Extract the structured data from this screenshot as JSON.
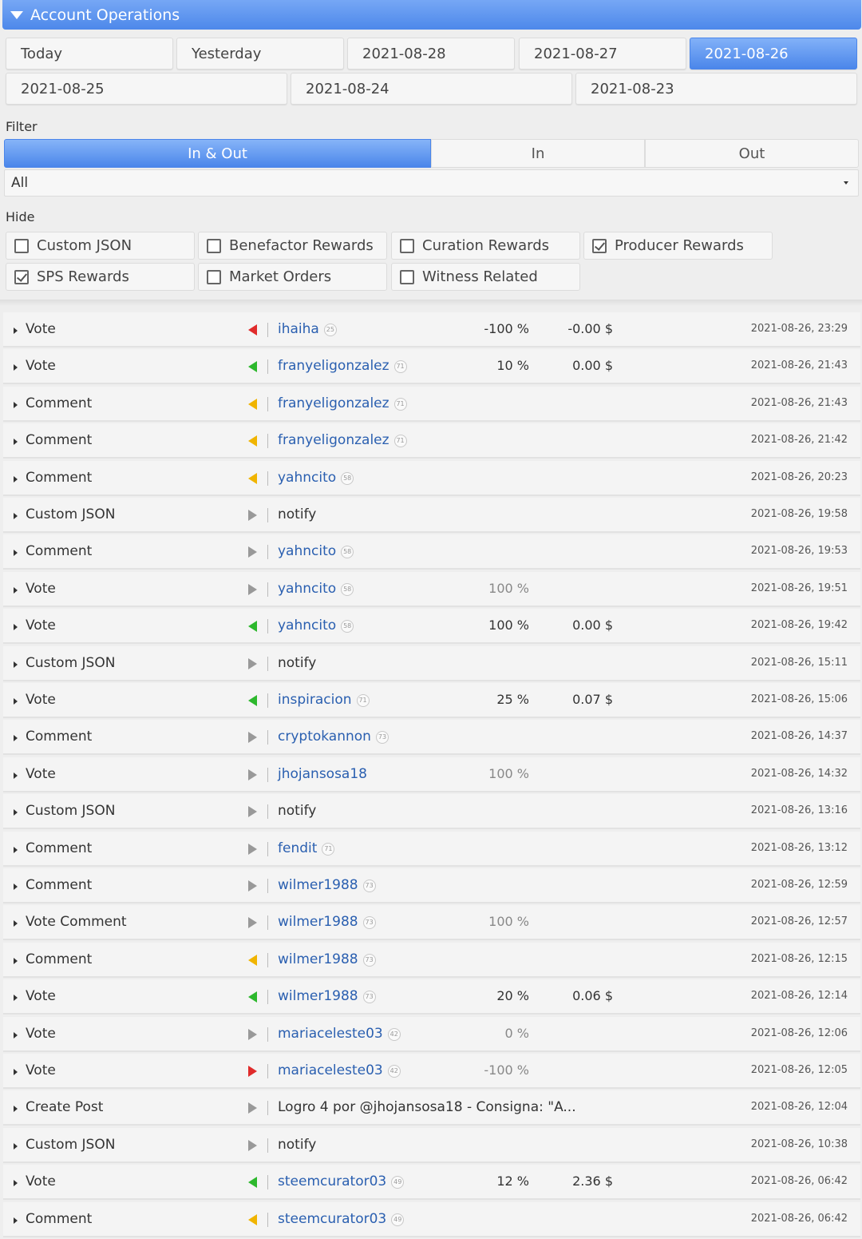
{
  "header": {
    "title": "Account Operations"
  },
  "dates": {
    "row1": [
      "Today",
      "Yesterday",
      "2021-08-28",
      "2021-08-27",
      "2021-08-26"
    ],
    "row2": [
      "2021-08-25",
      "2021-08-24",
      "2021-08-23"
    ],
    "selected": "2021-08-26"
  },
  "filter": {
    "label": "Filter",
    "segments": [
      "In & Out",
      "In",
      "Out"
    ],
    "selected_segment": "In & Out",
    "select_value": "All"
  },
  "hide": {
    "label": "Hide",
    "options": [
      {
        "label": "Custom JSON",
        "checked": false
      },
      {
        "label": "Benefactor Rewards",
        "checked": false
      },
      {
        "label": "Curation Rewards",
        "checked": false
      },
      {
        "label": "Producer Rewards",
        "checked": true
      },
      {
        "label": "SPS Rewards",
        "checked": true
      },
      {
        "label": "Market Orders",
        "checked": false
      },
      {
        "label": "Witness Related",
        "checked": false
      }
    ]
  },
  "colors": {
    "accent": "#4d88ea",
    "in_green": "#2db82d",
    "out_red": "#e02b2b",
    "comment_orange": "#f0b400",
    "neutral_gray": "#999999",
    "link_blue": "#2a5fb0"
  },
  "operations": [
    {
      "type": "Vote",
      "dir": "left",
      "color": "red",
      "account": "ihaiha",
      "rep": "25",
      "pct": "-100 %",
      "pct_gray": false,
      "amount": "-0.00 $",
      "ts": "2021-08-26, 23:29"
    },
    {
      "type": "Vote",
      "dir": "left",
      "color": "green",
      "account": "franyeligonzalez",
      "rep": "71",
      "pct": "10 %",
      "pct_gray": false,
      "amount": "0.00 $",
      "ts": "2021-08-26, 21:43"
    },
    {
      "type": "Comment",
      "dir": "left",
      "color": "orange",
      "account": "franyeligonzalez",
      "rep": "71",
      "pct": "",
      "pct_gray": false,
      "amount": "",
      "ts": "2021-08-26, 21:43"
    },
    {
      "type": "Comment",
      "dir": "left",
      "color": "orange",
      "account": "franyeligonzalez",
      "rep": "71",
      "pct": "",
      "pct_gray": false,
      "amount": "",
      "ts": "2021-08-26, 21:42"
    },
    {
      "type": "Comment",
      "dir": "left",
      "color": "orange",
      "account": "yahncito",
      "rep": "58",
      "pct": "",
      "pct_gray": false,
      "amount": "",
      "ts": "2021-08-26, 20:23"
    },
    {
      "type": "Custom JSON",
      "dir": "right",
      "color": "gray",
      "account": "notify",
      "rep": "",
      "plain": true,
      "pct": "",
      "pct_gray": false,
      "amount": "",
      "ts": "2021-08-26, 19:58"
    },
    {
      "type": "Comment",
      "dir": "right",
      "color": "gray",
      "account": "yahncito",
      "rep": "58",
      "pct": "",
      "pct_gray": false,
      "amount": "",
      "ts": "2021-08-26, 19:53"
    },
    {
      "type": "Vote",
      "dir": "right",
      "color": "gray",
      "account": "yahncito",
      "rep": "58",
      "pct": "100 %",
      "pct_gray": true,
      "amount": "",
      "ts": "2021-08-26, 19:51"
    },
    {
      "type": "Vote",
      "dir": "left",
      "color": "green",
      "account": "yahncito",
      "rep": "58",
      "pct": "100 %",
      "pct_gray": false,
      "amount": "0.00 $",
      "ts": "2021-08-26, 19:42"
    },
    {
      "type": "Custom JSON",
      "dir": "right",
      "color": "gray",
      "account": "notify",
      "rep": "",
      "plain": true,
      "pct": "",
      "pct_gray": false,
      "amount": "",
      "ts": "2021-08-26, 15:11"
    },
    {
      "type": "Vote",
      "dir": "left",
      "color": "green",
      "account": "inspiracion",
      "rep": "71",
      "pct": "25 %",
      "pct_gray": false,
      "amount": "0.07 $",
      "ts": "2021-08-26, 15:06"
    },
    {
      "type": "Comment",
      "dir": "right",
      "color": "gray",
      "account": "cryptokannon",
      "rep": "73",
      "pct": "",
      "pct_gray": false,
      "amount": "",
      "ts": "2021-08-26, 14:37"
    },
    {
      "type": "Vote",
      "dir": "right",
      "color": "gray",
      "account": "jhojansosa18",
      "rep": "",
      "pct": "100 %",
      "pct_gray": true,
      "amount": "",
      "ts": "2021-08-26, 14:32"
    },
    {
      "type": "Custom JSON",
      "dir": "right",
      "color": "gray",
      "account": "notify",
      "rep": "",
      "plain": true,
      "pct": "",
      "pct_gray": false,
      "amount": "",
      "ts": "2021-08-26, 13:16"
    },
    {
      "type": "Comment",
      "dir": "right",
      "color": "gray",
      "account": "fendit",
      "rep": "71",
      "pct": "",
      "pct_gray": false,
      "amount": "",
      "ts": "2021-08-26, 13:12"
    },
    {
      "type": "Comment",
      "dir": "right",
      "color": "gray",
      "account": "wilmer1988",
      "rep": "73",
      "pct": "",
      "pct_gray": false,
      "amount": "",
      "ts": "2021-08-26, 12:59"
    },
    {
      "type": "Vote Comment",
      "dir": "right",
      "color": "gray",
      "account": "wilmer1988",
      "rep": "73",
      "pct": "100 %",
      "pct_gray": true,
      "amount": "",
      "ts": "2021-08-26, 12:57"
    },
    {
      "type": "Comment",
      "dir": "left",
      "color": "orange",
      "account": "wilmer1988",
      "rep": "73",
      "pct": "",
      "pct_gray": false,
      "amount": "",
      "ts": "2021-08-26, 12:15"
    },
    {
      "type": "Vote",
      "dir": "left",
      "color": "green",
      "account": "wilmer1988",
      "rep": "73",
      "pct": "20 %",
      "pct_gray": false,
      "amount": "0.06 $",
      "ts": "2021-08-26, 12:14"
    },
    {
      "type": "Vote",
      "dir": "right",
      "color": "gray",
      "account": "mariaceleste03",
      "rep": "42",
      "pct": "0 %",
      "pct_gray": true,
      "amount": "",
      "ts": "2021-08-26, 12:06"
    },
    {
      "type": "Vote",
      "dir": "right",
      "color": "red",
      "account": "mariaceleste03",
      "rep": "42",
      "pct": "-100 %",
      "pct_gray": true,
      "amount": "",
      "ts": "2021-08-26, 12:05"
    },
    {
      "type": "Create Post",
      "dir": "right",
      "color": "gray",
      "account": "Logro 4 por @jhojansosa18 - Consigna: \"A...",
      "rep": "",
      "plain": true,
      "pct": "",
      "pct_gray": false,
      "amount": "",
      "ts": "2021-08-26, 12:04"
    },
    {
      "type": "Custom JSON",
      "dir": "right",
      "color": "gray",
      "account": "notify",
      "rep": "",
      "plain": true,
      "pct": "",
      "pct_gray": false,
      "amount": "",
      "ts": "2021-08-26, 10:38"
    },
    {
      "type": "Vote",
      "dir": "left",
      "color": "green",
      "account": "steemcurator03",
      "rep": "49",
      "pct": "12 %",
      "pct_gray": false,
      "amount": "2.36 $",
      "ts": "2021-08-26, 06:42"
    },
    {
      "type": "Comment",
      "dir": "left",
      "color": "orange",
      "account": "steemcurator03",
      "rep": "49",
      "pct": "",
      "pct_gray": false,
      "amount": "",
      "ts": "2021-08-26, 06:42"
    }
  ]
}
